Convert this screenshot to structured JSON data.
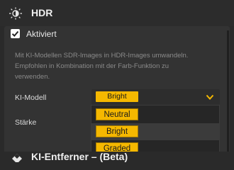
{
  "header": {
    "icon": "hdr-sun-icon",
    "title": "HDR"
  },
  "toggle": {
    "label": "Aktiviert",
    "checked": true
  },
  "description": {
    "line1": "Mit KI-Modellen SDR-Images in HDR-Images umwandeln.",
    "line2": "Empfohlen in Kombination mit der Farb-Funktion zu",
    "line3": "verwenden."
  },
  "fields": {
    "model_label": "KI-Modell",
    "strength_label": "Stärke"
  },
  "model_select": {
    "selected": "Bright",
    "options": [
      "Neutral",
      "Bright",
      "Graded"
    ],
    "hovered": "Bright"
  },
  "footer": {
    "icon": "eraser-icon",
    "title": "KI-Entferner – (Beta)"
  },
  "colors": {
    "accent": "#f5b800",
    "background": "#2a2a2a",
    "panel": "#333333"
  }
}
